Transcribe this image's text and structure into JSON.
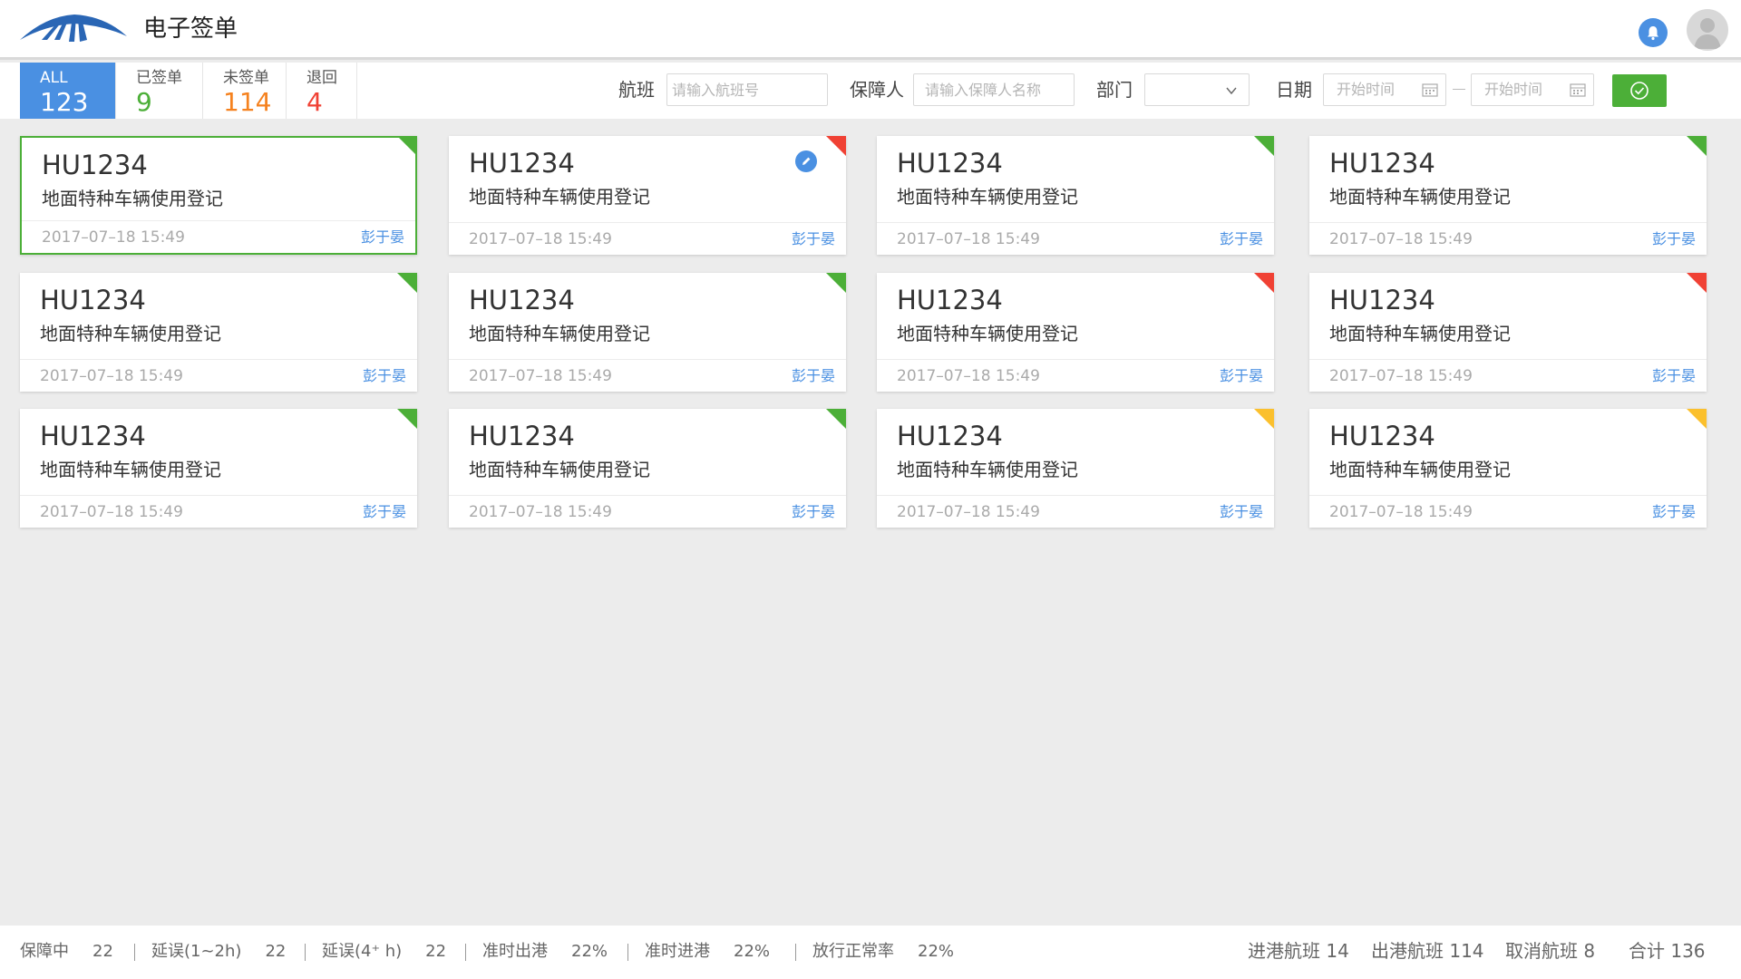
{
  "header": {
    "title": "电子签单"
  },
  "tabs": [
    {
      "label": "ALL",
      "count": "123",
      "color": "#ffffff"
    },
    {
      "label": "已签单",
      "count": "9",
      "color": "#4caf38"
    },
    {
      "label": "未签单",
      "count": "114",
      "color": "#f5821f"
    },
    {
      "label": "退回",
      "count": "4",
      "color": "#f04134"
    }
  ],
  "filters": {
    "flight_label": "航班",
    "flight_placeholder": "请输入航班号",
    "person_label": "保障人",
    "person_placeholder": "请输入保障人名称",
    "dept_label": "部门",
    "dept_value": "",
    "date_label": "日期",
    "date_start": "开始时间",
    "date_end": "开始时间"
  },
  "cards": [
    {
      "flight": "HU1234",
      "task": "地面特种车辆使用登记",
      "time": "2017–07–18 15:49",
      "user": "彭于晏",
      "status_color": "#4caf38",
      "selected": true,
      "edit": false
    },
    {
      "flight": "HU1234",
      "task": "地面特种车辆使用登记",
      "time": "2017–07–18 15:49",
      "user": "彭于晏",
      "status_color": "#f04134",
      "selected": false,
      "edit": true
    },
    {
      "flight": "HU1234",
      "task": "地面特种车辆使用登记",
      "time": "2017–07–18 15:49",
      "user": "彭于晏",
      "status_color": "#4caf38",
      "selected": false,
      "edit": false
    },
    {
      "flight": "HU1234",
      "task": "地面特种车辆使用登记",
      "time": "2017–07–18 15:49",
      "user": "彭于晏",
      "status_color": "#4caf38",
      "selected": false,
      "edit": false
    },
    {
      "flight": "HU1234",
      "task": "地面特种车辆使用登记",
      "time": "2017–07–18 15:49",
      "user": "彭于晏",
      "status_color": "#4caf38",
      "selected": false,
      "edit": false
    },
    {
      "flight": "HU1234",
      "task": "地面特种车辆使用登记",
      "time": "2017–07–18 15:49",
      "user": "彭于晏",
      "status_color": "#4caf38",
      "selected": false,
      "edit": false
    },
    {
      "flight": "HU1234",
      "task": "地面特种车辆使用登记",
      "time": "2017–07–18 15:49",
      "user": "彭于晏",
      "status_color": "#f04134",
      "selected": false,
      "edit": false
    },
    {
      "flight": "HU1234",
      "task": "地面特种车辆使用登记",
      "time": "2017–07–18 15:49",
      "user": "彭于晏",
      "status_color": "#f04134",
      "selected": false,
      "edit": false
    },
    {
      "flight": "HU1234",
      "task": "地面特种车辆使用登记",
      "time": "2017–07–18 15:49",
      "user": "彭于晏",
      "status_color": "#4caf38",
      "selected": false,
      "edit": false
    },
    {
      "flight": "HU1234",
      "task": "地面特种车辆使用登记",
      "time": "2017–07–18 15:49",
      "user": "彭于晏",
      "status_color": "#4caf38",
      "selected": false,
      "edit": false
    },
    {
      "flight": "HU1234",
      "task": "地面特种车辆使用登记",
      "time": "2017–07–18 15:49",
      "user": "彭于晏",
      "status_color": "#fbc02d",
      "selected": false,
      "edit": false
    },
    {
      "flight": "HU1234",
      "task": "地面特种车辆使用登记",
      "time": "2017–07–18 15:49",
      "user": "彭于晏",
      "status_color": "#fbc02d",
      "selected": false,
      "edit": false
    }
  ],
  "footer": {
    "stats": [
      {
        "label": "保障中",
        "value": "22"
      },
      {
        "label": "延误(1~2h)",
        "value": "22"
      },
      {
        "label": "延误(4⁺ h)",
        "value": "22"
      },
      {
        "label": "准时出港",
        "value": "22%"
      },
      {
        "label": "准时进港",
        "value": "22%"
      },
      {
        "label": "放行正常率",
        "value": "22%"
      }
    ],
    "totals": [
      {
        "label": "进港航班",
        "value": "14"
      },
      {
        "label": "出港航班",
        "value": "114"
      },
      {
        "label": "取消航班",
        "value": "8"
      },
      {
        "label": "合计",
        "value": "136"
      }
    ]
  }
}
